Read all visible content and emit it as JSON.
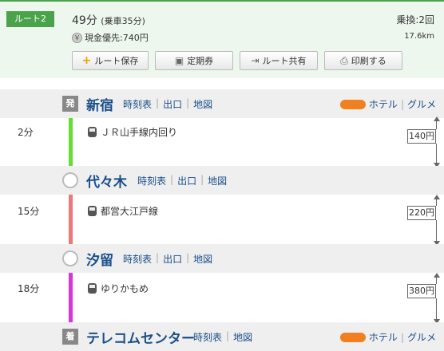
{
  "route": {
    "tag": "ルート2",
    "total_time": "49分",
    "ride_time": "(乗車35分)",
    "fare_label": "現金優先:740円",
    "transfers": "乗換:2回",
    "distance": "17.6km",
    "coin_icon_text": "￥"
  },
  "buttons": [
    {
      "label": "ルート保存",
      "icon": "plus-icon"
    },
    {
      "label": "定期券",
      "icon": "pass-icon"
    },
    {
      "label": "ルート共有",
      "icon": "share-icon"
    },
    {
      "label": "印刷する",
      "icon": "printer-icon"
    }
  ],
  "stations": [
    {
      "marker": "発",
      "name": "新宿",
      "links": [
        "時刻表",
        "出口",
        "地図"
      ],
      "extras": [
        "ホテル",
        "グルメ"
      ]
    },
    {
      "marker": "",
      "name": "代々木",
      "links": [
        "時刻表",
        "出口",
        "地図"
      ],
      "extras": []
    },
    {
      "marker": "",
      "name": "汐留",
      "links": [
        "時刻表",
        "出口",
        "地図"
      ],
      "extras": []
    },
    {
      "marker": "着",
      "name": "テレコムセンター",
      "links": [
        "時刻表",
        "地図"
      ],
      "extras": [
        "ホテル",
        "グルメ"
      ]
    }
  ],
  "segments": [
    {
      "duration": "2分",
      "line": "ＪＲ山手線内回り",
      "fare": "140円",
      "color": "#66dd33"
    },
    {
      "duration": "15分",
      "line": "都営大江戸線",
      "fare": "220円",
      "color": "#ee7777"
    },
    {
      "duration": "18分",
      "line": "ゆりかもめ",
      "fare": "380円",
      "color": "#dd33dd"
    }
  ]
}
